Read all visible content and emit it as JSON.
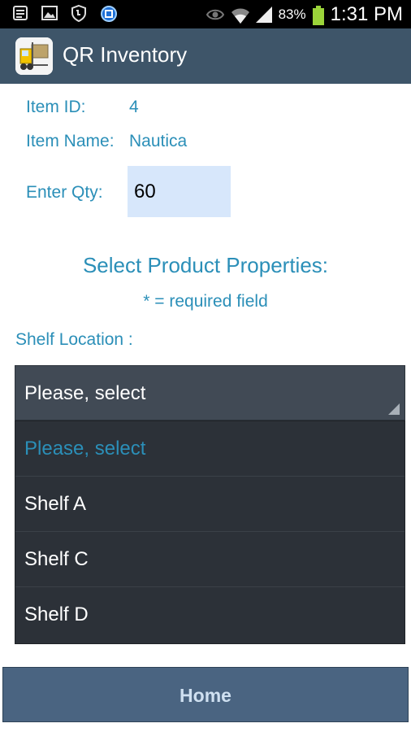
{
  "status_bar": {
    "battery_percent": "83%",
    "time": "1:31 PM"
  },
  "app_bar": {
    "title": "QR Inventory"
  },
  "form": {
    "item_id_label": "Item ID:",
    "item_id_value": "4",
    "item_name_label": "Item Name:",
    "item_name_value": "Nautica",
    "qty_label": "Enter Qty:",
    "qty_value": "60"
  },
  "properties": {
    "title": "Select Product Properties:",
    "required_note": "* = required field",
    "shelf_label": "Shelf Location :",
    "spinner_selected": "Please, select",
    "options": [
      "Please, select",
      "Shelf A",
      "Shelf C",
      "Shelf D"
    ]
  },
  "footer": {
    "home_label": "Home"
  },
  "colors": {
    "accent": "#2b8fb8",
    "app_bar": "#3e5569",
    "home_button": "#4a6481",
    "input_bg": "#d7e7fb",
    "dropdown_bg": "#2c3138"
  }
}
